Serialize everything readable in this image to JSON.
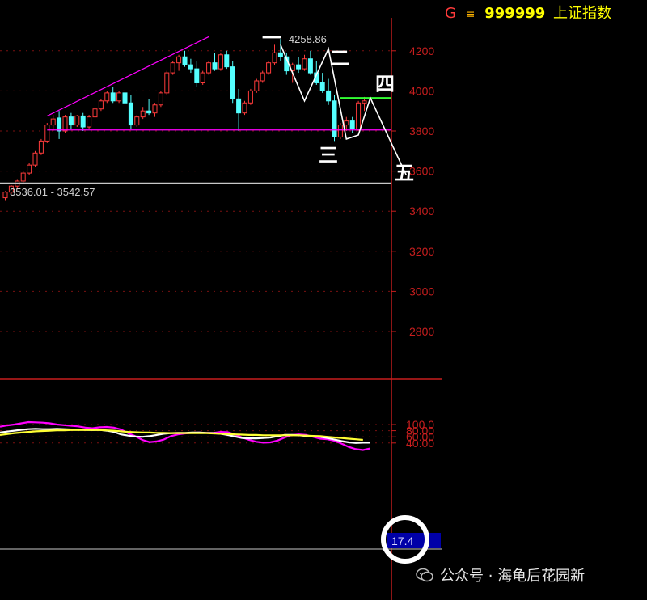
{
  "header": {
    "market_letter": "G",
    "market_symbol": "≡",
    "code": "999999",
    "name": "上证指数"
  },
  "colors": {
    "background": "#000000",
    "up_candle": "#ff3b3b",
    "down_candle": "#54ffff",
    "axis": "#c81e1e",
    "grid": "#7a1010",
    "magenta": "#ff00ff",
    "white": "#ffffff",
    "yellow": "#ffff33",
    "green": "#33ff33",
    "label_box": "#0000a8"
  },
  "chart_data": [
    {
      "type": "candlestick",
      "y_ticks": [
        "4200",
        "4000",
        "3800",
        "3600",
        "3400",
        "3200",
        "3000",
        "2800"
      ],
      "ylim": [
        2700,
        4300
      ],
      "candles": [
        [
          3467,
          3500,
          3455,
          3495
        ],
        [
          3495,
          3530,
          3485,
          3525
        ],
        [
          3525,
          3560,
          3515,
          3550
        ],
        [
          3550,
          3600,
          3540,
          3590
        ],
        [
          3590,
          3640,
          3580,
          3630
        ],
        [
          3630,
          3700,
          3620,
          3690
        ],
        [
          3690,
          3760,
          3680,
          3750
        ],
        [
          3750,
          3840,
          3740,
          3830
        ],
        [
          3830,
          3880,
          3800,
          3860
        ],
        [
          3865,
          3900,
          3760,
          3800
        ],
        [
          3800,
          3880,
          3790,
          3870
        ],
        [
          3870,
          3890,
          3810,
          3830
        ],
        [
          3830,
          3880,
          3820,
          3875
        ],
        [
          3875,
          3890,
          3800,
          3820
        ],
        [
          3820,
          3880,
          3810,
          3870
        ],
        [
          3870,
          3920,
          3860,
          3910
        ],
        [
          3910,
          3960,
          3900,
          3950
        ],
        [
          3950,
          4000,
          3940,
          3990
        ],
        [
          3990,
          4020,
          3940,
          3950
        ],
        [
          3950,
          4000,
          3940,
          3990
        ],
        [
          3990,
          4030,
          3930,
          3940
        ],
        [
          3940,
          3980,
          3810,
          3830
        ],
        [
          3830,
          3880,
          3820,
          3870
        ],
        [
          3870,
          3920,
          3860,
          3900
        ],
        [
          3900,
          3960,
          3880,
          3890
        ],
        [
          3890,
          3940,
          3870,
          3930
        ],
        [
          3930,
          4000,
          3920,
          3990
        ],
        [
          3990,
          4100,
          3980,
          4090
        ],
        [
          4090,
          4150,
          4080,
          4140
        ],
        [
          4140,
          4180,
          4100,
          4170
        ],
        [
          4170,
          4200,
          4120,
          4130
        ],
        [
          4130,
          4160,
          4090,
          4110
        ],
        [
          4110,
          4150,
          4020,
          4040
        ],
        [
          4040,
          4100,
          4030,
          4090
        ],
        [
          4090,
          4150,
          4080,
          4140
        ],
        [
          4140,
          4190,
          4100,
          4110
        ],
        [
          4110,
          4190,
          4100,
          4180
        ],
        [
          4180,
          4200,
          4110,
          4120
        ],
        [
          4120,
          4150,
          3940,
          3960
        ],
        [
          3960,
          4010,
          3800,
          3890
        ],
        [
          3890,
          3950,
          3880,
          3940
        ],
        [
          3940,
          4010,
          3930,
          4000
        ],
        [
          4000,
          4060,
          3990,
          4050
        ],
        [
          4050,
          4100,
          4040,
          4090
        ],
        [
          4090,
          4150,
          4080,
          4140
        ],
        [
          4140,
          4230,
          4130,
          4190
        ],
        [
          4190,
          4258.86,
          4150,
          4170
        ],
        [
          4170,
          4190,
          4080,
          4100
        ],
        [
          4100,
          4140,
          4040,
          4130
        ],
        [
          4130,
          4170,
          4090,
          4110
        ],
        [
          4110,
          4180,
          4100,
          4160
        ],
        [
          4160,
          4200,
          4080,
          4090
        ],
        [
          4090,
          4150,
          4030,
          4040
        ],
        [
          4040,
          4090,
          3990,
          4000
        ],
        [
          4000,
          4060,
          3930,
          3950
        ],
        [
          3950,
          3980,
          3750,
          3770
        ],
        [
          3770,
          3840,
          3760,
          3830
        ],
        [
          3830,
          3870,
          3800,
          3850
        ],
        [
          3850,
          3870,
          3790,
          3810
        ],
        [
          3810,
          3950,
          3800,
          3940
        ],
        [
          3940,
          3970,
          3900,
          3950
        ]
      ],
      "annotations": {
        "high_label": "4258.86",
        "level_label": "3536.01 - 3542.57",
        "wave_labels": [
          "一",
          "二",
          "三",
          "四",
          "五"
        ]
      }
    },
    {
      "type": "line",
      "y_ticks": [
        "100.0",
        "80.00",
        "60.00",
        "40.00"
      ],
      "ylim": [
        10,
        115
      ],
      "current_value_label": "17.4",
      "series": [
        {
          "color": "magenta",
          "values": [
            93,
            97,
            100,
            104,
            108,
            107,
            106,
            104,
            100,
            98,
            96,
            94,
            90,
            88,
            91,
            92,
            90,
            84,
            72,
            62,
            50,
            43,
            45,
            51,
            62,
            68,
            71,
            73,
            74,
            73,
            73,
            76,
            75,
            68,
            58,
            50,
            44,
            41,
            42,
            48,
            58,
            66,
            68,
            66,
            60,
            54,
            52,
            47,
            38,
            27,
            20,
            17,
            22
          ]
        },
        {
          "color": "white",
          "values": [
            74,
            77,
            80,
            83,
            85,
            86,
            85,
            85,
            86,
            85,
            84,
            84,
            83,
            82,
            83,
            80,
            76,
            68,
            64,
            61,
            60,
            62,
            66,
            70,
            72,
            73,
            73,
            74,
            74,
            73,
            72,
            70,
            66,
            61,
            56,
            55,
            55,
            56,
            58,
            62,
            66,
            66,
            65,
            63,
            62,
            60,
            56,
            51,
            46,
            42,
            40,
            41,
            41
          ]
        },
        {
          "color": "yellow",
          "values": [
            66,
            69,
            72,
            74,
            76,
            78,
            79,
            80,
            81,
            81,
            82,
            82,
            82,
            82,
            82,
            81,
            80,
            78,
            76,
            75,
            74,
            74,
            73,
            73,
            72,
            72,
            72,
            72,
            72,
            72,
            71,
            70,
            69,
            68,
            67,
            66,
            66,
            65,
            65,
            65,
            65,
            65,
            65,
            64,
            63,
            62,
            60,
            58,
            56,
            54,
            52,
            50
          ]
        }
      ]
    }
  ],
  "watermark": {
    "text": "公众号 · 海龟后花园新"
  }
}
